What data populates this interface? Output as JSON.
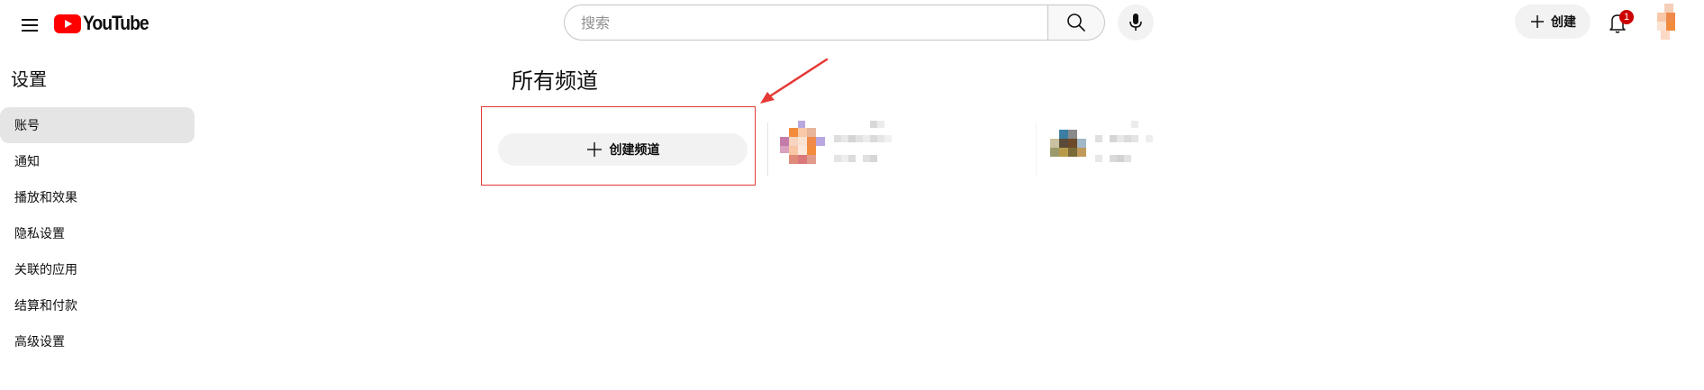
{
  "header": {
    "logo_text": "YouTube",
    "logo_color": "#ff0000",
    "search": {
      "placeholder": "搜索",
      "value": ""
    },
    "create_label": "创建",
    "notification_count": "1",
    "icons": [
      "menu-icon",
      "search-icon",
      "mic-icon",
      "plus-icon",
      "bell-icon"
    ]
  },
  "sidebar": {
    "title": "设置",
    "items": [
      {
        "label": "账号",
        "active": true
      },
      {
        "label": "通知",
        "active": false
      },
      {
        "label": "播放和效果",
        "active": false
      },
      {
        "label": "隐私设置",
        "active": false
      },
      {
        "label": "关联的应用",
        "active": false
      },
      {
        "label": "结算和付款",
        "active": false
      },
      {
        "label": "高级设置",
        "active": false
      }
    ]
  },
  "main": {
    "title": "所有频道",
    "create_channel_label": "创建频道",
    "annotation_color": "#e53935"
  }
}
